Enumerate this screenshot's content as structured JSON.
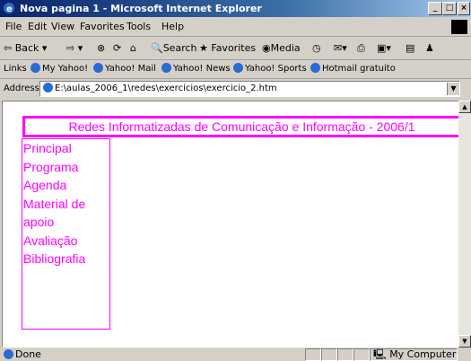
{
  "window": {
    "title": "Nova pagina 1 - Microsoft Internet Explorer",
    "min_label": "_",
    "max_label": "□",
    "close_label": "×"
  },
  "menu": {
    "items": [
      "File",
      "Edit",
      "View",
      "Favorites",
      "Tools",
      "Help"
    ]
  },
  "toolbar": {
    "back_label": "Back",
    "search_label": "Search",
    "favorites_label": "Favorites",
    "media_label": "Media"
  },
  "links": {
    "label": "Links",
    "items": [
      "My Yahoo!",
      "Yahoo! Mail",
      "Yahoo! News",
      "Yahoo! Sports",
      "Hotmail gratuito"
    ]
  },
  "address": {
    "label": "Address",
    "value": "E:\\aulas_2006_1\\redes\\exercicios\\exercicio_2.htm"
  },
  "page": {
    "title": "Redes Informatizadas de Comunicação e Informação - 2006/1",
    "nav": [
      "Principal",
      "Programa",
      "Agenda",
      "Material de apoio",
      "Avaliação",
      "Bibliografia"
    ]
  },
  "status": {
    "text": "Done",
    "zone": "My Computer"
  }
}
